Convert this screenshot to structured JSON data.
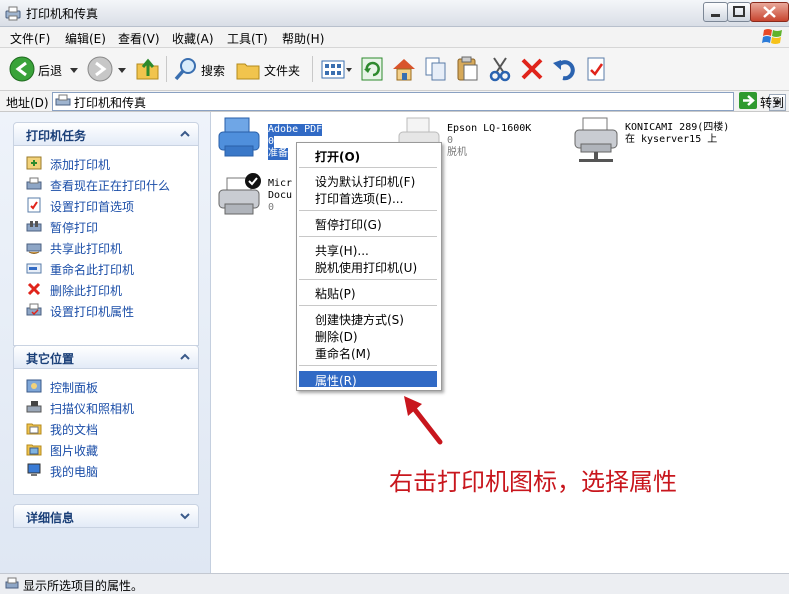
{
  "window": {
    "title": "打印机和传真"
  },
  "menubar": [
    "文件(F)",
    "编辑(E)",
    "查看(V)",
    "收藏(A)",
    "工具(T)",
    "帮助(H)"
  ],
  "toolbar": {
    "back_label": "后退",
    "search_label": "搜索",
    "folders_label": "文件夹"
  },
  "address": {
    "label": "地址(D)",
    "value": "打印机和传真",
    "go_label": "转到"
  },
  "printer_tasks": {
    "title": "打印机任务",
    "items": [
      "添加打印机",
      "查看现在正在打印什么",
      "设置打印首选项",
      "暂停打印",
      "共享此打印机",
      "重命名此打印机",
      "删除此打印机",
      "设置打印机属性"
    ]
  },
  "other_places": {
    "title": "其它位置",
    "items": [
      "控制面板",
      "扫描仪和照相机",
      "我的文档",
      "图片收藏",
      "我的电脑"
    ]
  },
  "details": {
    "title": "详细信息"
  },
  "printers": [
    {
      "name": "Adobe PDF",
      "count": "0",
      "status": "准备"
    },
    {
      "name": "Epson LQ-1600K",
      "count": "0",
      "status": "脱机"
    },
    {
      "name": "KONICAMI 289(四楼)",
      "count": "在 kyserver15 上"
    },
    {
      "name": "Micr",
      "line2": "Docu",
      "count": "0"
    }
  ],
  "context_menu": {
    "items": [
      "打开(O)",
      "设为默认打印机(F)",
      "打印首选项(E)...",
      "暂停打印(G)",
      "共享(H)...",
      "脱机使用打印机(U)",
      "粘贴(P)",
      "创建快捷方式(S)",
      "删除(D)",
      "重命名(M)",
      "属性(R)"
    ],
    "highlighted": "属性(R)"
  },
  "status": {
    "text": "显示所选项目的属性。"
  },
  "annotation": {
    "text": "右击打印机图标，选择属性"
  },
  "colors": {
    "highlight": "#316ac5",
    "annotation": "#c8161d",
    "link": "#1b4ea8"
  }
}
